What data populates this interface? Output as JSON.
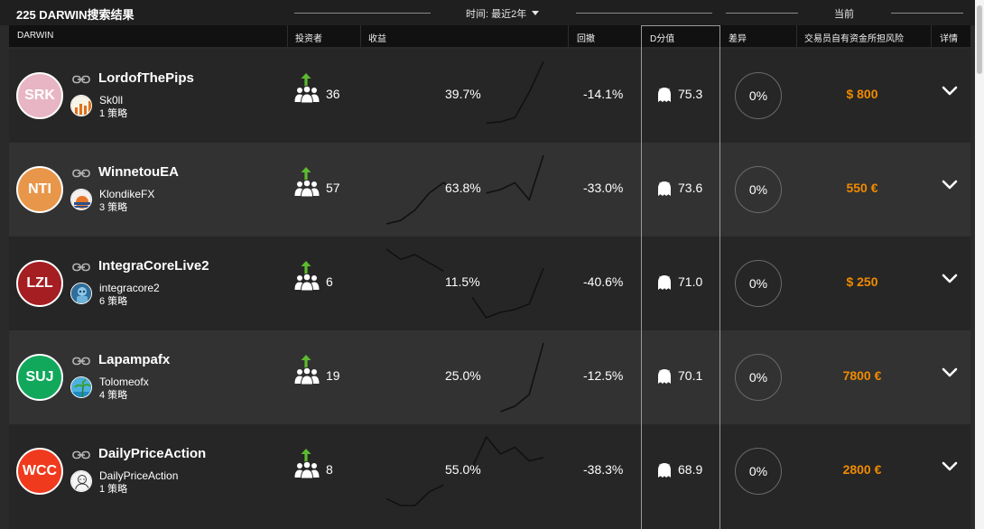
{
  "toolbar": {
    "result_title": "225 DARWIN搜索结果",
    "time_filter": "时间: 最近2年",
    "current_label": "当前"
  },
  "columns": {
    "darwin": "DARWIN",
    "investors": "投资者",
    "return": "收益",
    "drawdown": "回撤",
    "dscore": "D分值",
    "divergence": "差异",
    "trader_risk": "交易员自有资金所担风险",
    "details": "详情"
  },
  "colors": {
    "risk_value": "#f08a00",
    "investor_arrow": "#5dbb2f",
    "panel_bg": "#2a2a2a"
  },
  "rows": [
    {
      "ticker": "SRK",
      "avatar_color": "#e7b5c4",
      "name": "LordofThePips",
      "trader": "Sk0ll",
      "strategies": "1 策略",
      "trader_icon": "bar-chart-logo",
      "investors": "36",
      "return": "39.7%",
      "drawdown": "-14.1%",
      "dscore": "75.3",
      "divergence": "0%",
      "trader_risk": "$ 800",
      "sparkline": [
        null,
        null,
        null,
        null,
        null,
        null,
        null,
        0.1,
        0.12,
        0.18,
        0.55,
        1.0
      ]
    },
    {
      "ticker": "NTI",
      "avatar_color": "#e8974a",
      "name": "WinnetouEA",
      "trader": "KlondikeFX",
      "strategies": "3 策略",
      "trader_icon": "sunset-logo",
      "investors": "57",
      "return": "63.8%",
      "drawdown": "-33.0%",
      "dscore": "73.6",
      "divergence": "0%",
      "trader_risk": "550 €",
      "sparkline": [
        0.0,
        0.05,
        0.2,
        0.45,
        0.6,
        0.45,
        null,
        0.45,
        0.5,
        0.6,
        0.35,
        1.0
      ]
    },
    {
      "ticker": "LZL",
      "avatar_color": "#a51e22",
      "name": "IntegraCoreLive2",
      "trader": "integracore2",
      "strategies": "6 策略",
      "trader_icon": "robot-logo",
      "investors": "6",
      "return": "11.5%",
      "drawdown": "-40.6%",
      "dscore": "71.0",
      "divergence": "0%",
      "trader_risk": "$ 250",
      "sparkline": [
        1.0,
        0.85,
        0.92,
        0.8,
        0.68,
        null,
        0.3,
        0.0,
        0.08,
        0.12,
        0.2,
        0.72
      ]
    },
    {
      "ticker": "SUJ",
      "avatar_color": "#12a85c",
      "name": "Lapampafx",
      "trader": "Tolomeofx",
      "strategies": "4 策略",
      "trader_icon": "palm-beach-logo",
      "investors": "19",
      "return": "25.0%",
      "drawdown": "-12.5%",
      "dscore": "70.1",
      "divergence": "0%",
      "trader_risk": "7800 €",
      "sparkline": [
        null,
        null,
        null,
        null,
        null,
        null,
        null,
        null,
        0.0,
        0.08,
        0.25,
        1.0
      ]
    },
    {
      "ticker": "WCC",
      "avatar_color": "#f03a1e",
      "name": "DailyPriceAction",
      "trader": "DailyPriceAction",
      "strategies": "1 策略",
      "trader_icon": "portrait-sketch-logo",
      "investors": "8",
      "return": "55.0%",
      "drawdown": "-38.3%",
      "dscore": "68.9",
      "divergence": "0%",
      "trader_risk": "2800 €",
      "sparkline": [
        0.1,
        0.0,
        0.0,
        0.2,
        0.3,
        null,
        0.55,
        1.0,
        0.75,
        0.85,
        0.65,
        0.7
      ]
    }
  ]
}
